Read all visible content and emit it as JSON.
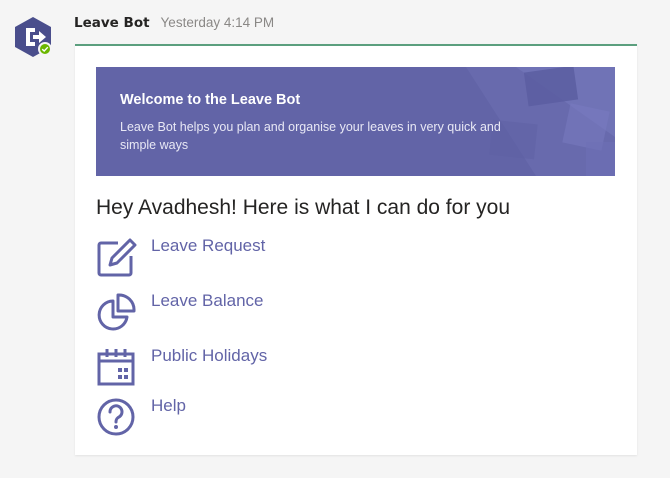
{
  "message": {
    "sender": "Leave Bot",
    "timestamp": "Yesterday 4:14 PM",
    "avatar_icon": "exit-arrow-hexagon-icon",
    "presence_status": "available",
    "accent_color": "#5b9f7e"
  },
  "card": {
    "banner": {
      "title": "Welcome to the Leave Bot",
      "text": "Leave Bot helps you plan and organise your leaves in very quick and simple ways",
      "color": "#6264a7"
    },
    "greeting": "Hey Avadhesh! Here is what I can do for you",
    "actions": [
      {
        "label": "Leave Request",
        "icon": "edit-icon"
      },
      {
        "label": "Leave Balance",
        "icon": "pie-chart-icon"
      },
      {
        "label": "Public Holidays",
        "icon": "calendar-icon"
      },
      {
        "label": "Help",
        "icon": "help-icon"
      }
    ],
    "link_color": "#6264a7"
  }
}
